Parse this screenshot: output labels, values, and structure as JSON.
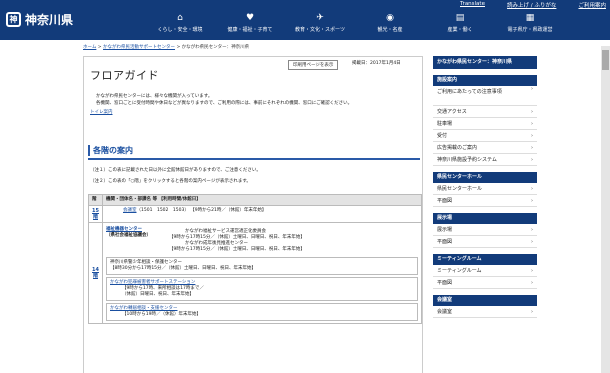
{
  "header": {
    "logo": "神奈川県",
    "logo_mark": "神",
    "toplinks": [
      "Translate",
      "読み上げ / ふりがな",
      "ご利用案内"
    ],
    "nav": [
      {
        "icon": "⌂",
        "label": "くらし・安全・環境"
      },
      {
        "icon": "♥",
        "label": "健康・福祉・子育て"
      },
      {
        "icon": "✈",
        "label": "教育・文化・スポーツ"
      },
      {
        "icon": "◉",
        "label": "観光・名産"
      },
      {
        "icon": "▤",
        "label": "産業・働く"
      },
      {
        "icon": "▦",
        "label": "電子県庁・県政運営"
      }
    ]
  },
  "breadcrumb": {
    "home": "ホーム",
    "sep1": " > ",
    "l1": "かながわ県民活動サポートセンター",
    "sep2": " > ",
    "l2": "かながわ県民センター：神奈川県"
  },
  "main": {
    "title": "フロアガイド",
    "print": "印刷用ページを表示",
    "updated": "掲載日：2017年1月4日",
    "intro1": "かながわ県民センターには、様々な機関が入っています。",
    "intro2": "各機関、窓口ごとに受付時間や休日などが異なりますので、ご利用の際には、事前にそれぞれの機関、窓口にご確認ください。",
    "toilet": "トイレ案内",
    "section": "各階の案内",
    "note1": "（注１）この表に記載された日以外に全館休館日がありますので、ご注意ください。",
    "note2": "（注２）この表の「○階」をクリックすると各階の案内ページが表示されます。",
    "th_floor": "階",
    "th_org": "機関・団体名・部課名 等 【利用時間/休館日】",
    "f15": "15階",
    "f15_org": "会議室",
    "f15_num": "（1501　1502　1503）",
    "f15_time": "【9時から21時／（休館）年末年始】",
    "welfare": "福祉機器センター",
    "welfare2": "（県社会福祉協議会）",
    "kfukushi": "かながわ福祉サービス運営適正化委員会",
    "kfukushi_time": "【9時から17時15分／（休館）土曜日、日曜日、祝日、年末年始】",
    "kseinen": "かながわ成年後見推進センター",
    "kseinen_time": "【9時から17時15分／（休館）土曜日、日曜日、祝日、年末年始】",
    "f14": "14階",
    "seishonen": "神奈川県警少年相談・保護センター",
    "seishonen_time": "【8時30分から17時15分／（休館）土曜日、日曜日、祝日、年末年始】",
    "hanzai": "かながわ犯罪被害者サポートステーション",
    "hanzai_time1": "【9時から17時、来所相談は17時まで／",
    "hanzai_time2": "（休館）日曜日、祝日、年末年始】",
    "tenki": "かながわ轉居相談・支援センター",
    "tenki_time": "【10時から19時／（休館）年末年始】"
  },
  "sidebar": {
    "top_banner": "かながわ県民センター：神奈川県",
    "g1": {
      "head": "施設案内",
      "items": [
        "ご利用にあたっての注意事項",
        "交通アクセス",
        "駐車場",
        "受付",
        "広告掲載のご案内",
        "神奈川県施設予約システム"
      ]
    },
    "g2": {
      "head": "県民センターホール",
      "items": [
        "県民センターホール",
        "平面図"
      ]
    },
    "g3": {
      "head": "展示場",
      "items": [
        "展示場",
        "平面図"
      ]
    },
    "g4": {
      "head": "ミーティングルーム",
      "items": [
        "ミーティングルーム",
        "平面図"
      ]
    },
    "g5": {
      "head": "会議室",
      "items": [
        "会議室"
      ]
    }
  }
}
